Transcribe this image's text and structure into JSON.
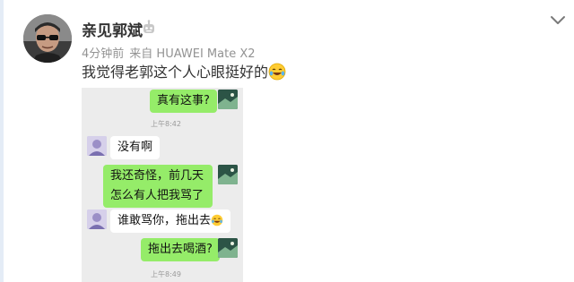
{
  "post": {
    "username": "亲见郭斌",
    "time_ago": "4分钟前",
    "source": "来自 HUAWEI Mate X2",
    "text": "我觉得老郭这个人心眼挺好的",
    "badge_icon": "robot-badge-icon",
    "more_icon": "chevron-down-icon",
    "text_emoji": "laugh-cry-emoji"
  },
  "chat": {
    "messages": [
      {
        "side": "me",
        "text": "真有这事?"
      },
      {
        "side": "time",
        "text": "上午8:42"
      },
      {
        "side": "them",
        "text": "没有啊"
      },
      {
        "side": "me",
        "text": "我还奇怪，前几天怎么有人把我骂了"
      },
      {
        "side": "them",
        "text": "谁敢骂你，拖出去"
      },
      {
        "side": "me",
        "text": "拖出去喝酒?"
      },
      {
        "side": "time",
        "text": "上午8:49"
      }
    ]
  },
  "colors": {
    "bubble_out": "#95ec69",
    "bubble_in": "#ffffff",
    "chat_background": "#ececec",
    "meta_text": "#939393"
  }
}
